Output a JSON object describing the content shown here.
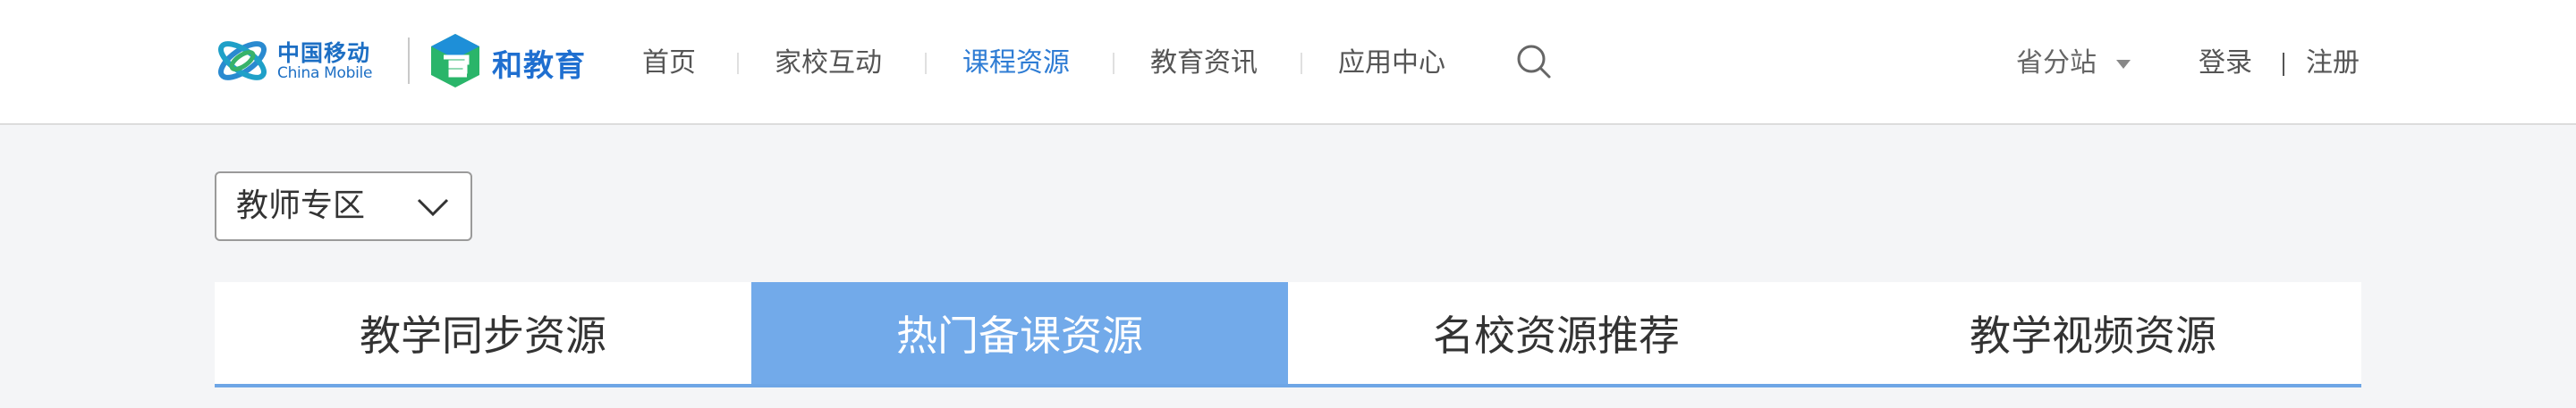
{
  "brand": {
    "mobile_cn": "中国移动",
    "mobile_en": "China Mobile",
    "edu_name": "和教育",
    "icons": [
      "china-mobile-logo-icon",
      "hejiaoyu-logo-icon"
    ]
  },
  "nav": {
    "items": [
      {
        "label": "首页",
        "active": false
      },
      {
        "label": "家校互动",
        "active": false
      },
      {
        "label": "课程资源",
        "active": true
      },
      {
        "label": "教育资讯",
        "active": false
      },
      {
        "label": "应用中心",
        "active": false
      }
    ],
    "search_icon": "search-icon"
  },
  "account": {
    "province_label": "省分站",
    "login_label": "登录",
    "register_label": "注册"
  },
  "zone_select": {
    "selected": "教师专区",
    "icon": "chevron-down-icon"
  },
  "tabs": [
    {
      "label": "教学同步资源",
      "active": false
    },
    {
      "label": "热门备课资源",
      "active": true
    },
    {
      "label": "名校资源推荐",
      "active": false
    },
    {
      "label": "教学视频资源",
      "active": false
    }
  ],
  "colors": {
    "accent": "#2e7cd4",
    "tab_active_bg": "#72aaea",
    "page_bg": "#f4f5f7",
    "header_bg": "#ffffff"
  }
}
